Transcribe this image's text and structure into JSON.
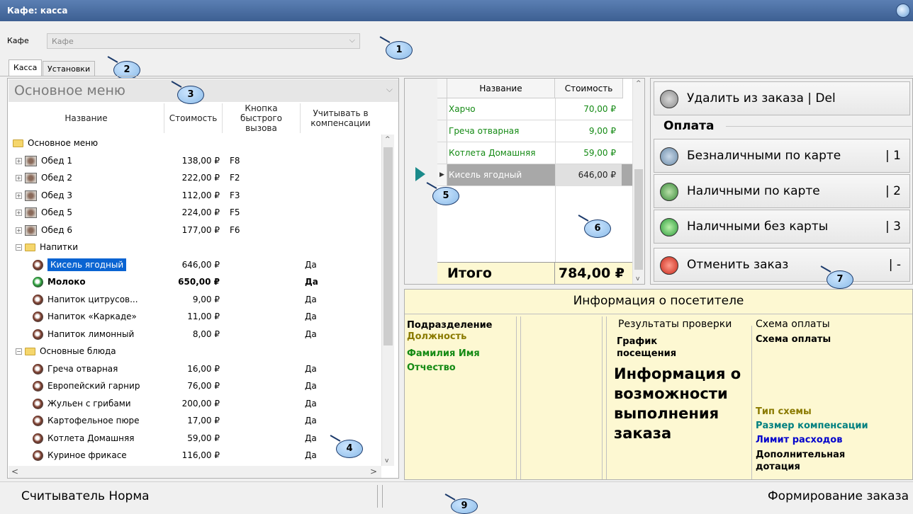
{
  "window": {
    "title": "Кафе: касса"
  },
  "cafe": {
    "label": "Кафе",
    "value": "Кафе"
  },
  "tabs": [
    {
      "label": "Касса"
    },
    {
      "label": "Установки"
    }
  ],
  "menu": {
    "selector": "Основное меню",
    "columns": {
      "name": "Название",
      "price": "Стоимость",
      "hotkey": "Кнопка быстрого вызова",
      "compensation": "Учитывать в компенсации"
    },
    "rows": [
      {
        "type": "folder",
        "level": 0,
        "name": "Основное меню",
        "price": "",
        "hotkey": "",
        "comp": ""
      },
      {
        "type": "set",
        "level": 1,
        "name": "Обед 1",
        "price": "138,00 ₽",
        "hotkey": "F8",
        "comp": ""
      },
      {
        "type": "set",
        "level": 1,
        "name": "Обед 2",
        "price": "222,00 ₽",
        "hotkey": "F2",
        "comp": ""
      },
      {
        "type": "set",
        "level": 1,
        "name": "Обед 3",
        "price": "112,00 ₽",
        "hotkey": "F3",
        "comp": ""
      },
      {
        "type": "set",
        "level": 1,
        "name": "Обед 5",
        "price": "224,00 ₽",
        "hotkey": "F5",
        "comp": ""
      },
      {
        "type": "set",
        "level": 1,
        "name": "Обед 6",
        "price": "177,00 ₽",
        "hotkey": "F6",
        "comp": ""
      },
      {
        "type": "folder",
        "level": 1,
        "name": "Напитки",
        "price": "",
        "hotkey": "",
        "comp": ""
      },
      {
        "type": "drink",
        "level": 2,
        "name": "Кисель ягодный",
        "price": "646,00 ₽",
        "hotkey": "",
        "comp": "Да",
        "selected": true
      },
      {
        "type": "drink-green",
        "level": 2,
        "name": "Молоко",
        "price": "650,00 ₽",
        "hotkey": "",
        "comp": "Да",
        "bold": true
      },
      {
        "type": "drink",
        "level": 2,
        "name": "Напиток  цитрусов...",
        "price": "9,00 ₽",
        "hotkey": "",
        "comp": "Да"
      },
      {
        "type": "drink",
        "level": 2,
        "name": "Напиток «Каркаде»",
        "price": "11,00 ₽",
        "hotkey": "",
        "comp": "Да"
      },
      {
        "type": "drink",
        "level": 2,
        "name": "Напиток лимонный",
        "price": "8,00 ₽",
        "hotkey": "",
        "comp": "Да"
      },
      {
        "type": "folder",
        "level": 1,
        "name": "Основные блюда",
        "price": "",
        "hotkey": "",
        "comp": ""
      },
      {
        "type": "drink",
        "level": 2,
        "name": "Греча отварная",
        "price": "16,00 ₽",
        "hotkey": "",
        "comp": "Да"
      },
      {
        "type": "drink",
        "level": 2,
        "name": "Европейский гарнир",
        "price": "76,00 ₽",
        "hotkey": "",
        "comp": "Да"
      },
      {
        "type": "drink",
        "level": 2,
        "name": "Жульен с грибами",
        "price": "200,00 ₽",
        "hotkey": "",
        "comp": "Да"
      },
      {
        "type": "drink",
        "level": 2,
        "name": "Картофельное пюре",
        "price": "17,00 ₽",
        "hotkey": "",
        "comp": "Да"
      },
      {
        "type": "drink",
        "level": 2,
        "name": "Котлета Домашняя",
        "price": "59,00 ₽",
        "hotkey": "",
        "comp": "Да"
      },
      {
        "type": "drink",
        "level": 2,
        "name": "Куриное фрикасе",
        "price": "116,00 ₽",
        "hotkey": "",
        "comp": "Да"
      }
    ]
  },
  "order": {
    "columns": {
      "name": "Название",
      "price": "Стоимость"
    },
    "rows": [
      {
        "name": "Харчо",
        "price": "70,00 ₽"
      },
      {
        "name": "Греча отварная",
        "price": "9,00 ₽"
      },
      {
        "name": "Котлета Домашняя",
        "price": "59,00 ₽"
      },
      {
        "name": "Кисель ягодный",
        "price": "646,00 ₽",
        "selected": true
      }
    ],
    "total_label": "Итого",
    "total_value": "784,00 ₽"
  },
  "actions": {
    "delete": {
      "label": "Удалить из заказа | Del"
    },
    "payment_title": "Оплата",
    "card_cashless": {
      "label": "Безналичными по карте",
      "key": "| 1"
    },
    "card_cash": {
      "label": "Наличными по карте",
      "key": "| 2"
    },
    "cash_no_card": {
      "label": "Наличными без карты",
      "key": "| 3"
    },
    "cancel": {
      "label": "Отменить заказ",
      "key": "| -"
    }
  },
  "visitor": {
    "title": "Информация о посетителе",
    "department": "Подразделение",
    "position": "Должность",
    "fio": "Фамилия Имя Отчество",
    "check_title": "Результаты проверки",
    "schedule": "График посещения",
    "possibility": "Информация о возможности выполнения заказа",
    "scheme_title": "Схема оплаты",
    "scheme": "Схема оплаты",
    "scheme_type": "Тип схемы",
    "comp_size": "Размер компенсации",
    "limit": "Лимит расходов",
    "extra": "Дополнительная дотация"
  },
  "status": {
    "left": "Считыватель Норма",
    "right": "Формирование заказа"
  },
  "callouts": [
    "1",
    "2",
    "3",
    "4",
    "5",
    "6",
    "7",
    "9"
  ],
  "colors": {
    "title_bar": "#3d5f92",
    "selection": "#0a64d2",
    "info_bg": "#fdf8d2",
    "green_text": "#148a14",
    "olive_text": "#8a7a00",
    "teal_text": "#008080",
    "blue_text": "#0000cc"
  }
}
